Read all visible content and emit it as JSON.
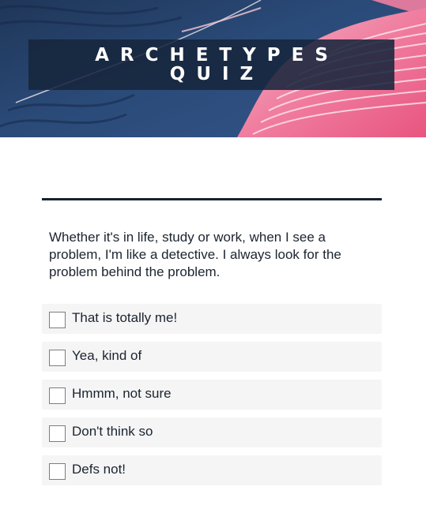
{
  "header": {
    "title_line_1": "ARCHETYPES",
    "title_line_2": "QUIZ",
    "background_colors": {
      "navy": "#2a4a78",
      "pink": "#f07ea0",
      "overlay": "#17263c"
    }
  },
  "question": {
    "text": "Whether it's in life, study or work, when I see a problem, I'm like a detective. I always look for the problem behind the problem."
  },
  "options": [
    {
      "label": "That is totally me!",
      "checked": false
    },
    {
      "label": "Yea, kind of",
      "checked": false
    },
    {
      "label": "Hmmm, not sure",
      "checked": false
    },
    {
      "label": "Don't think so",
      "checked": false
    },
    {
      "label": "Defs not!",
      "checked": false
    }
  ]
}
